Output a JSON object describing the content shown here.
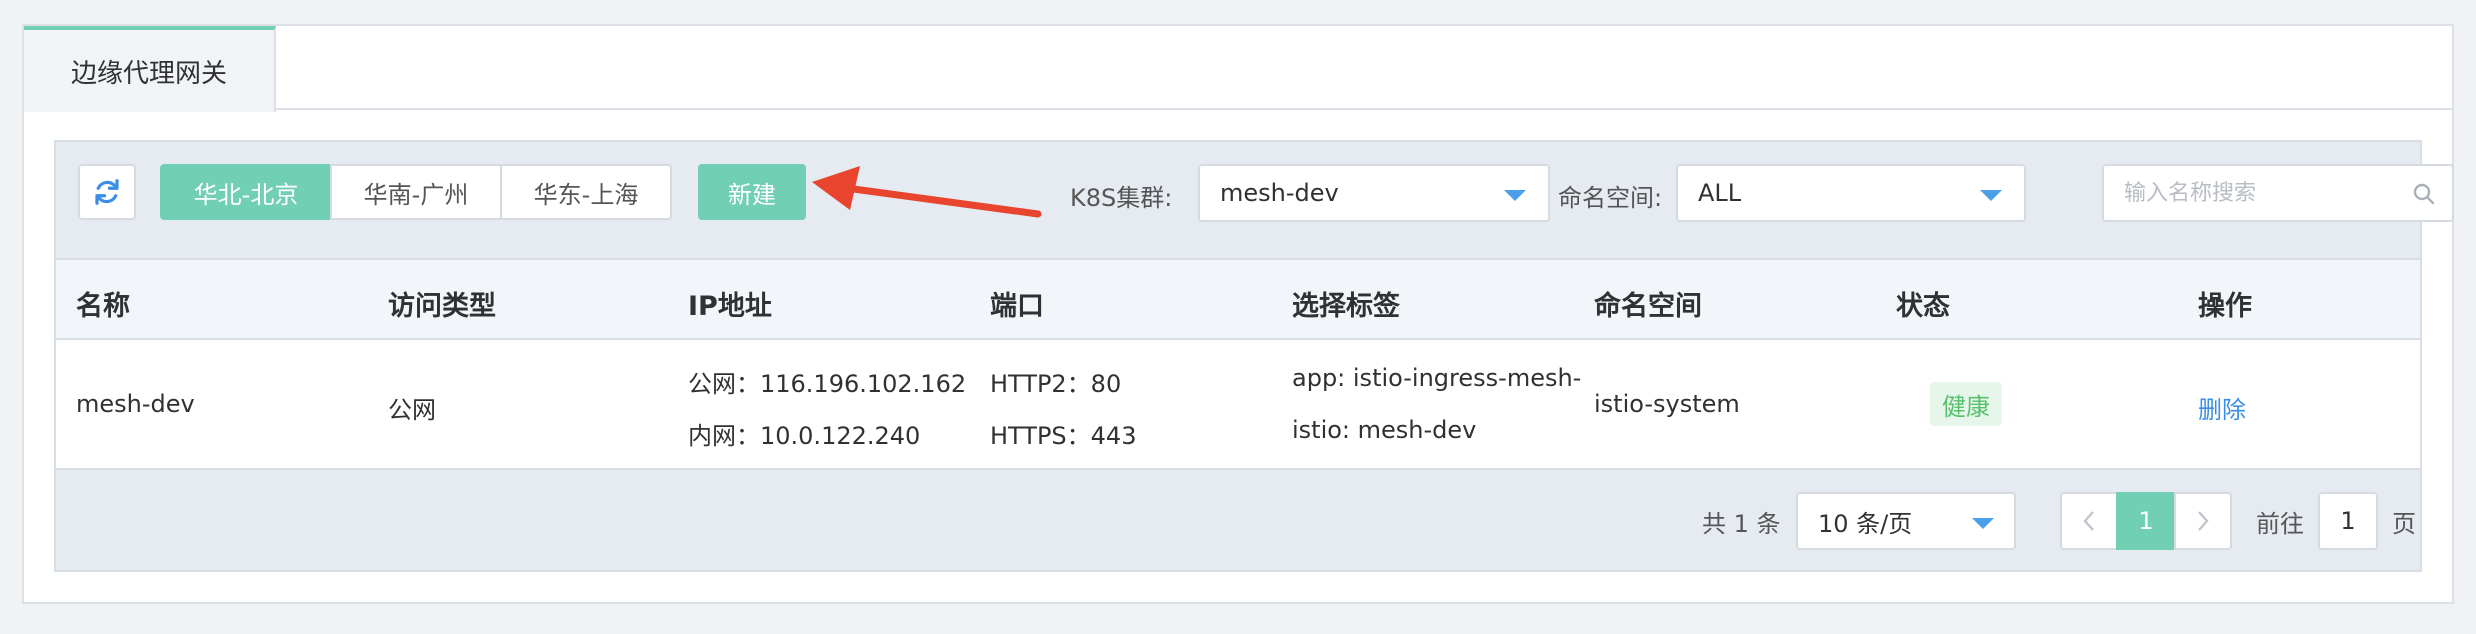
{
  "tabs": [
    {
      "label": "边缘代理网关"
    }
  ],
  "toolbar": {
    "regions": [
      "华北-北京",
      "华南-广州",
      "华东-上海"
    ],
    "active_region_index": 0,
    "new_label": "新建",
    "cluster_label": "K8S集群:",
    "cluster_value": "mesh-dev",
    "namespace_label": "命名空间:",
    "namespace_value": "ALL",
    "search_placeholder": "输入名称搜索"
  },
  "table": {
    "columns": [
      "名称",
      "访问类型",
      "IP地址",
      "端口",
      "选择标签",
      "命名空间",
      "状态",
      "操作"
    ],
    "rows": [
      {
        "name": "mesh-dev",
        "access_type": "公网",
        "ip_public": "公网：116.196.102.162",
        "ip_private": "内网：10.0.122.240",
        "port_1": "HTTP2：80",
        "port_2": "HTTPS：443",
        "label_1": "app: istio-ingress-mesh-",
        "label_2": "istio: mesh-dev",
        "namespace": "istio-system",
        "status": "健康",
        "action": "删除"
      }
    ]
  },
  "pagination": {
    "total_text": "共 1 条",
    "page_size": "10 条/页",
    "current_page": "1",
    "goto_prefix": "前往",
    "goto_value": "1",
    "goto_suffix": "页"
  },
  "colors": {
    "accent": "#71cfb4",
    "link": "#3a8ee6",
    "annotation_arrow": "#e8442e",
    "healthy": "#57c16c"
  }
}
